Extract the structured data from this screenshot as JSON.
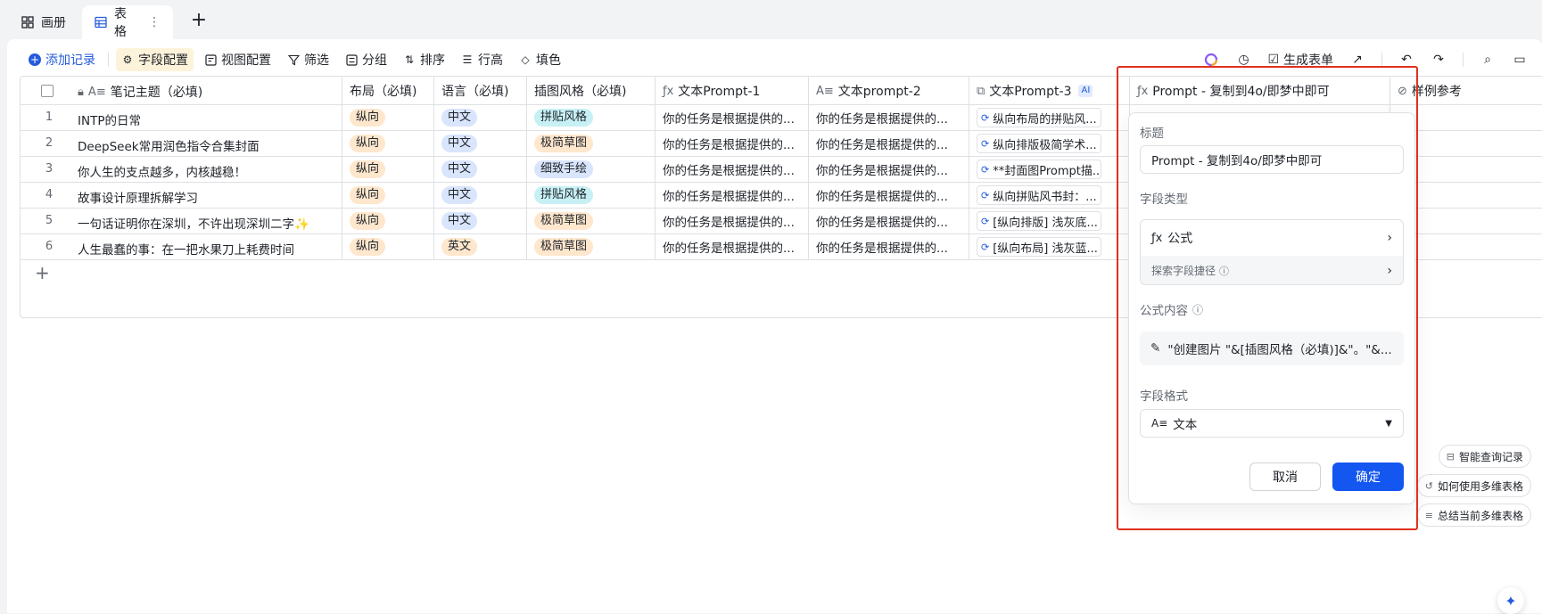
{
  "tabs": [
    {
      "label": "画册",
      "active": false
    },
    {
      "label": "表格",
      "active": true
    }
  ],
  "toolbar": {
    "add_record": "添加记录",
    "field_config": "字段配置",
    "view_config": "视图配置",
    "filter": "筛选",
    "group": "分组",
    "sort": "排序",
    "row_height": "行高",
    "fill": "填色",
    "generate_form": "生成表单"
  },
  "columns": [
    "笔记主题（必填)",
    "布局（必填)",
    "语言（必填)",
    "插图风格（必填)",
    "文本Prompt-1",
    "文本prompt-2",
    "文本Prompt-3",
    "Prompt - 复制到4o/即梦中即可",
    "样例参考"
  ],
  "ai_tag": "AI",
  "rows": [
    {
      "num": "1",
      "title": "INTP的日常",
      "layout": "纵向",
      "lang": "中文",
      "style": "拼贴风格",
      "style_color": "cyan",
      "p1": "你的任务是根据提供的...",
      "p2": "你的任务是根据提供的...",
      "p3": "纵向布局的拼贴风..."
    },
    {
      "num": "2",
      "title": "DeepSeek常用润色指令合集封面",
      "layout": "纵向",
      "lang": "中文",
      "style": "极简草图",
      "style_color": "orange",
      "p1": "你的任务是根据提供的...",
      "p2": "你的任务是根据提供的...",
      "p3": "纵向排版极简学术..."
    },
    {
      "num": "3",
      "title": "你人生的支点越多，内核越稳！",
      "layout": "纵向",
      "lang": "中文",
      "style": "细致手绘",
      "style_color": "blue",
      "p1": "你的任务是根据提供的...",
      "p2": "你的任务是根据提供的...",
      "p3": "**封面图Prompt描..."
    },
    {
      "num": "4",
      "title": "故事设计原理拆解学习",
      "layout": "纵向",
      "lang": "中文",
      "style": "拼贴风格",
      "style_color": "cyan",
      "p1": "你的任务是根据提供的...",
      "p2": "你的任务是根据提供的...",
      "p3": "纵向拼贴风书封：..."
    },
    {
      "num": "5",
      "title": "一句话证明你在深圳，不许出现深圳二字✨",
      "layout": "纵向",
      "lang": "中文",
      "style": "极简草图",
      "style_color": "orange",
      "p1": "你的任务是根据提供的...",
      "p2": "你的任务是根据提供的...",
      "p3": "[纵向排版] 浅灰底..."
    },
    {
      "num": "6",
      "title": "人生最蠢的事：在一把水果刀上耗费时间",
      "layout": "纵向",
      "lang": "英文",
      "style": "极简草图",
      "style_color": "orange",
      "p1": "你的任务是根据提供的...",
      "p2": "你的任务是根据提供的...",
      "p3": "[纵向布局] 浅灰蓝..."
    }
  ],
  "field_panel": {
    "title_label": "标题",
    "title_value": "Prompt - 复制到4o/即梦中即可",
    "type_label": "字段类型",
    "type_value": "公式",
    "explore_label": "探索字段捷径",
    "formula_label": "公式内容",
    "formula_value": "\"创建图片 \"&[插图风格（必填)]&\"。\"&...",
    "format_label": "字段格式",
    "format_value": "文本",
    "cancel": "取消",
    "confirm": "确定"
  },
  "quick_actions": [
    "智能查询记录",
    "如何使用多维表格",
    "总结当前多维表格"
  ]
}
